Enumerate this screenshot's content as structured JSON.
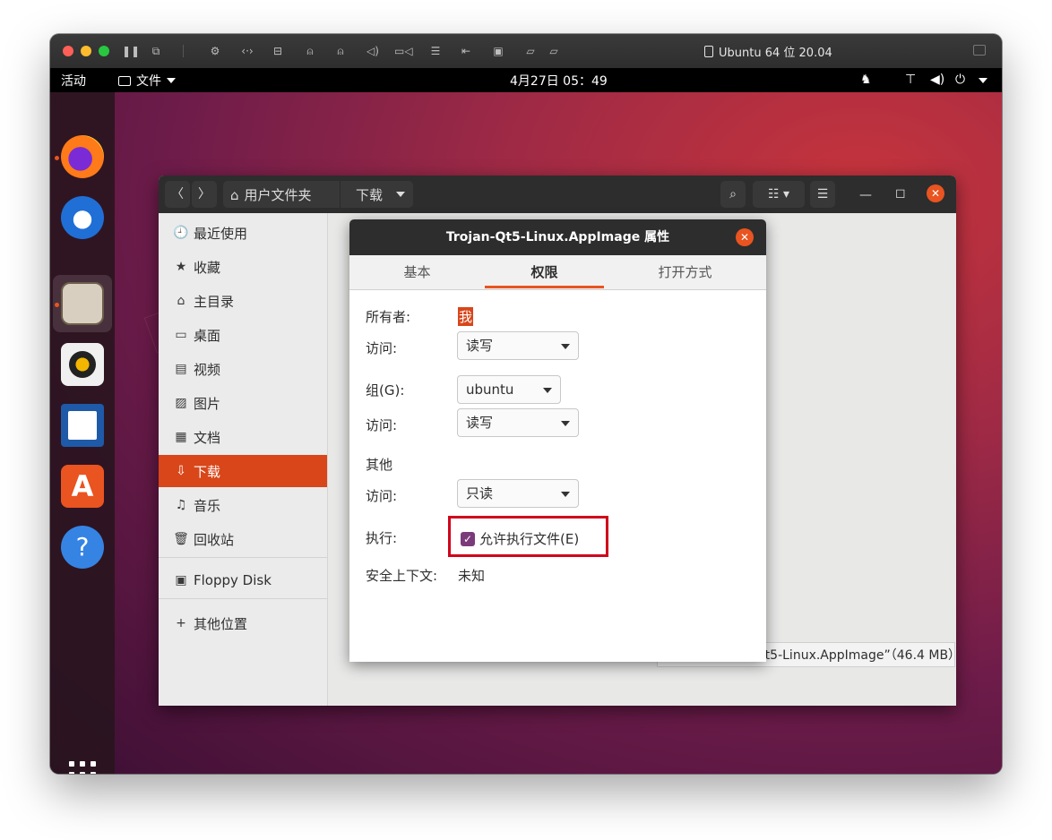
{
  "vm": {
    "title": "Ubuntu 64 位 20.04",
    "tools": [
      "pause-icon",
      "snapshot-icon",
      "settings-icon",
      "arrows-icon",
      "disk-icon",
      "person-icon",
      "person-icon",
      "volume-icon",
      "camera-icon",
      "storage-icon",
      "usb-icon",
      "save-icon",
      "folder-share-icon",
      "folder-share-icon"
    ]
  },
  "topbar": {
    "activities": "活动",
    "files_menu": "文件",
    "clock": "4月27日  05：49"
  },
  "nautilus": {
    "path": {
      "home": "用户文件夹",
      "current": "下载"
    },
    "sidebar": [
      {
        "icon": "🕘",
        "label": "最近使用"
      },
      {
        "icon": "★",
        "label": "收藏"
      },
      {
        "icon": "⌂",
        "label": "主目录"
      },
      {
        "icon": "▭",
        "label": "桌面"
      },
      {
        "icon": "▤",
        "label": "视频"
      },
      {
        "icon": "▨",
        "label": "图片"
      },
      {
        "icon": "▦",
        "label": "文档"
      },
      {
        "icon": "⇩",
        "label": "下载"
      },
      {
        "icon": "♫",
        "label": "音乐"
      },
      {
        "icon": "🗑",
        "label": "回收站"
      },
      {
        "icon": "▣",
        "label": "Floppy Disk"
      },
      {
        "icon": "+",
        "label": "其他位置"
      }
    ],
    "status": "已选中“Trojan-Qt5-Linux.AppImage”（46.4 MB）"
  },
  "dialog": {
    "title": "Trojan-Qt5-Linux.AppImage 属性",
    "tabs": [
      "基本",
      "权限",
      "打开方式"
    ],
    "active_tab": "权限",
    "owner_label": "所有者:",
    "owner_value": "我",
    "owner_access_label": "访问:",
    "owner_access": "读写",
    "group_label": "组(G):",
    "group_value": "ubuntu",
    "group_access_label": "访问:",
    "group_access": "读写",
    "others_label": "其他",
    "others_access_label": "访问:",
    "others_access": "只读",
    "exec_label": "执行:",
    "exec_checkbox": "允许执行文件(E)",
    "exec_checked": true,
    "security_label": "安全上下文:",
    "security_value": "未知"
  },
  "colors": {
    "accent": "#e95420",
    "highlight": "#d0021b",
    "checkbox": "#7b3b7a"
  }
}
